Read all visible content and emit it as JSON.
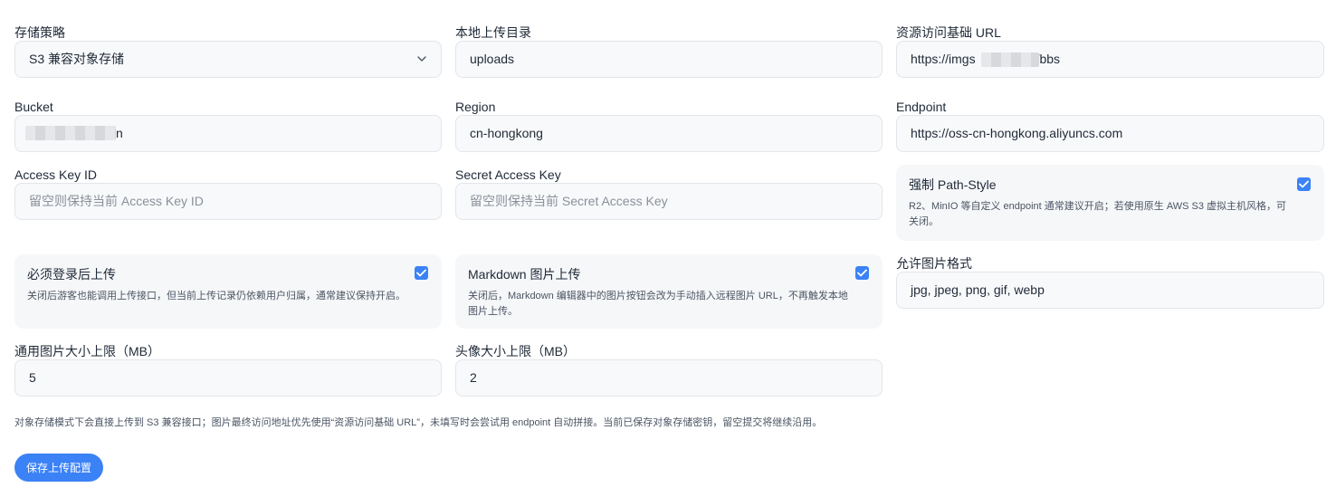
{
  "storage": {
    "label": "存储策略",
    "value": "S3 兼容对象存储"
  },
  "local_dir": {
    "label": "本地上传目录",
    "value": "uploads"
  },
  "base_url": {
    "label": "资源访问基础 URL",
    "value_prefix": "https://imgs",
    "value_suffix": "/bbs"
  },
  "bucket": {
    "label": "Bucket",
    "value_suffix": "n"
  },
  "region": {
    "label": "Region",
    "value": "cn-hongkong"
  },
  "endpoint": {
    "label": "Endpoint",
    "value": "https://oss-cn-hongkong.aliyuncs.com"
  },
  "access_key": {
    "label": "Access Key ID",
    "placeholder": "留空则保持当前 Access Key ID"
  },
  "secret_key": {
    "label": "Secret Access Key",
    "placeholder": "留空则保持当前 Secret Access Key"
  },
  "path_style": {
    "title": "强制 Path-Style",
    "desc": "R2、MinIO 等自定义 endpoint 通常建议开启；若使用原生 AWS S3 虚拟主机风格，可关闭。",
    "checked": true
  },
  "login_required": {
    "title": "必须登录后上传",
    "desc": "关闭后游客也能调用上传接口，但当前上传记录仍依赖用户归属，通常建议保持开启。",
    "checked": true
  },
  "markdown_upload": {
    "title": "Markdown 图片上传",
    "desc": "关闭后，Markdown 编辑器中的图片按钮会改为手动插入远程图片 URL，不再触发本地图片上传。",
    "checked": true
  },
  "formats": {
    "label": "允许图片格式",
    "value": "jpg, jpeg, png, gif, webp"
  },
  "image_size": {
    "label": "通用图片大小上限（MB）",
    "value": "5"
  },
  "avatar_size": {
    "label": "头像大小上限（MB）",
    "value": "2"
  },
  "note": "对象存储模式下会直接上传到 S3 兼容接口；图片最终访问地址优先使用“资源访问基础 URL”，未填写时会尝试用 endpoint 自动拼接。当前已保存对象存储密钥，留空提交将继续沿用。",
  "save_label": "保存上传配置",
  "colors": {
    "accent": "#3b82f6",
    "field_bg": "#f8f9fb",
    "card_bg": "#f6f7f9"
  }
}
